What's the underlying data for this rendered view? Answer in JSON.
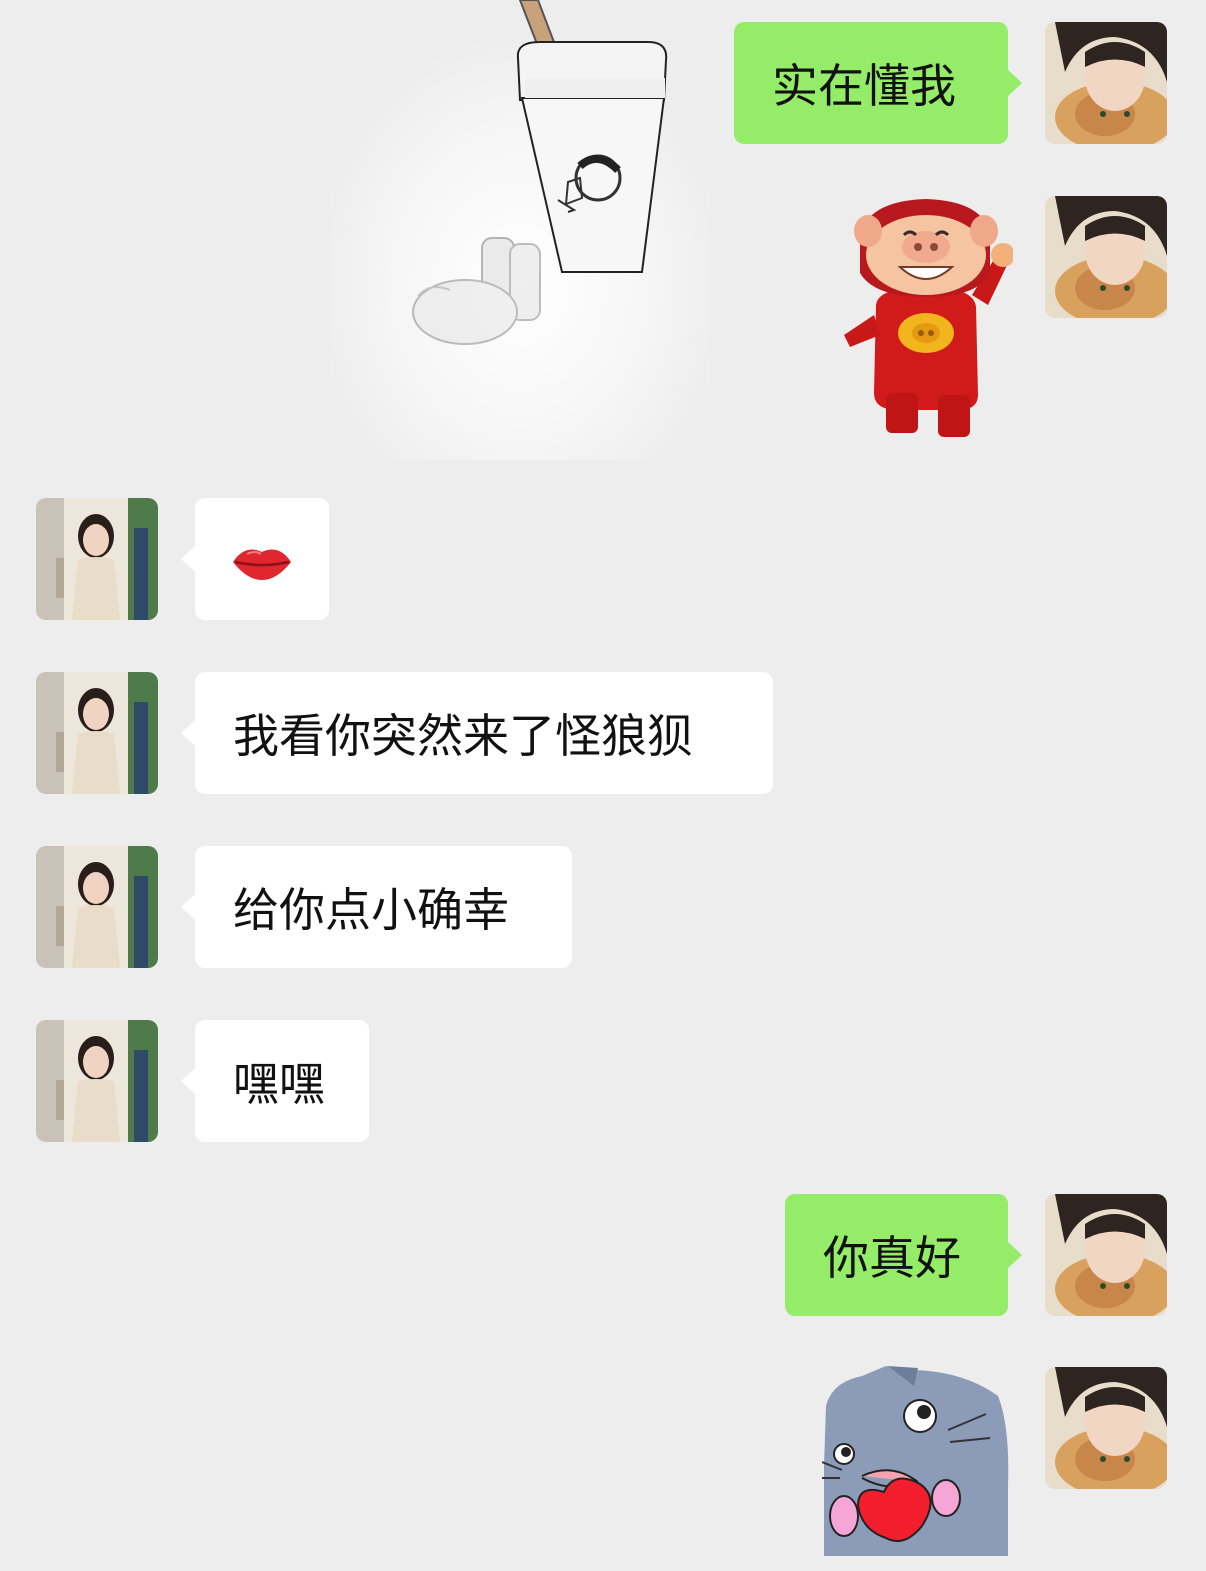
{
  "chat": {
    "background_color": "#EDEDED",
    "self_bubble_color": "#95EC69",
    "other_bubble_color": "#FFFFFF",
    "messages": [
      {
        "sender": "self",
        "type": "text",
        "text": "实在懂我"
      },
      {
        "sender": "other",
        "type": "sticker",
        "sticker": "milk-tea-cup-sticker"
      },
      {
        "sender": "self",
        "type": "sticker",
        "sticker": "red-pig-dancing-sticker"
      },
      {
        "sender": "other",
        "type": "emoji",
        "emoji": "👄"
      },
      {
        "sender": "other",
        "type": "text",
        "text": "我看你突然来了怪狼狈"
      },
      {
        "sender": "other",
        "type": "text",
        "text": "给你点小确幸"
      },
      {
        "sender": "other",
        "type": "text",
        "text": "嘿嘿"
      },
      {
        "sender": "self",
        "type": "text",
        "text": "你真好"
      },
      {
        "sender": "self",
        "type": "sticker",
        "sticker": "gray-cat-holding-heart-sticker"
      }
    ]
  }
}
